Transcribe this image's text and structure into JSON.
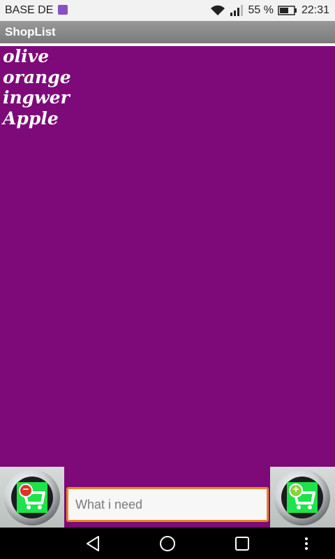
{
  "status_bar": {
    "carrier": "BASE DE",
    "battery_percent": "55 %",
    "time": "22:31"
  },
  "app": {
    "title": "ShopList"
  },
  "shopping_list": {
    "items": [
      "olive",
      "orange",
      "ingwer",
      "Apple"
    ]
  },
  "input": {
    "placeholder": "What i need",
    "value": ""
  },
  "icons": {
    "remove_button": "cart-remove-icon",
    "add_button": "cart-add-icon",
    "nav_back": "back-triangle-icon",
    "nav_home": "home-circle-icon",
    "nav_recents": "recents-square-icon",
    "nav_menu": "more-vertical-icon"
  },
  "colors": {
    "background": "#7d0a78",
    "title_bar": "#8a8a8a",
    "cart_green": "#1fe34a",
    "input_border": "#e8852a",
    "remove_badge": "#e43126",
    "add_badge": "#8bd23c"
  }
}
